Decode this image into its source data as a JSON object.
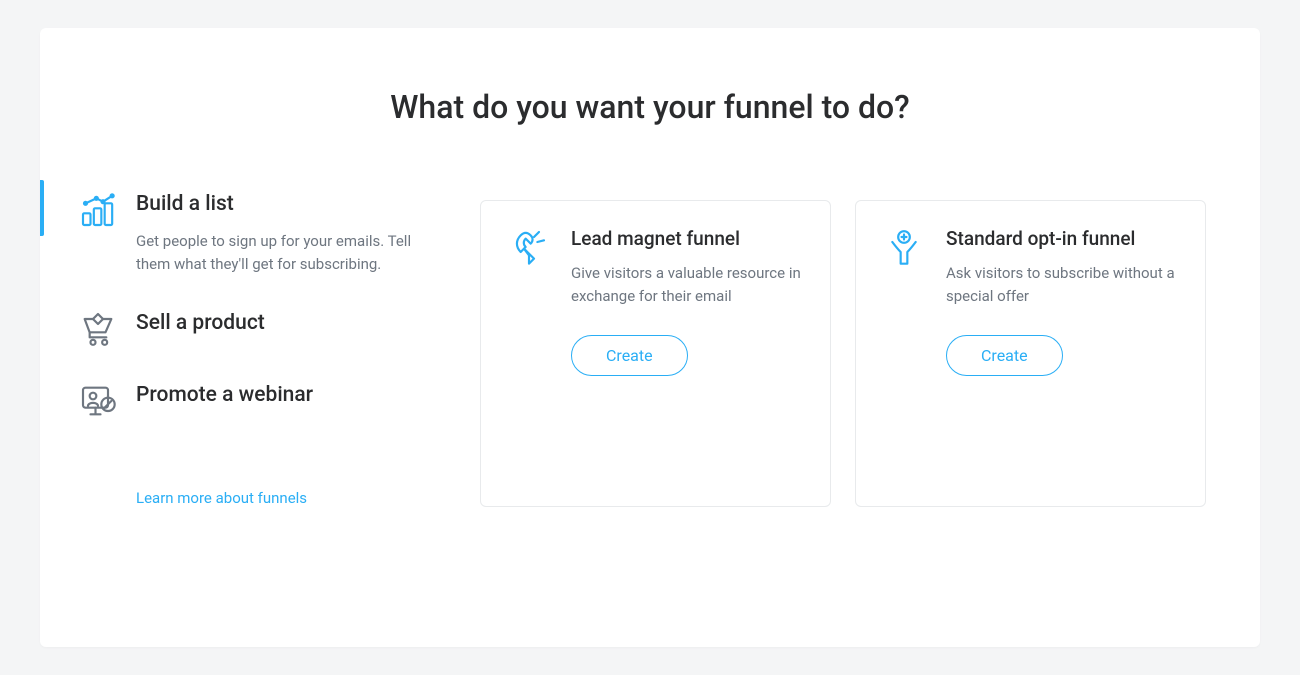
{
  "page_title": "What do you want your funnel to do?",
  "accent_color": "#2aaef5",
  "sidebar": {
    "items": [
      {
        "title": "Build a list",
        "description": "Get people to sign up for your emails. Tell them what they'll get for subscribing.",
        "active": true
      },
      {
        "title": "Sell a product",
        "description": "",
        "active": false
      },
      {
        "title": "Promote a webinar",
        "description": "",
        "active": false
      }
    ],
    "learn_more": "Learn more about funnels"
  },
  "funnels": [
    {
      "title": "Lead magnet funnel",
      "description": "Give visitors a valuable resource in exchange for their email",
      "button": "Create"
    },
    {
      "title": "Standard opt-in funnel",
      "description": "Ask visitors to subscribe without a special offer",
      "button": "Create"
    }
  ]
}
